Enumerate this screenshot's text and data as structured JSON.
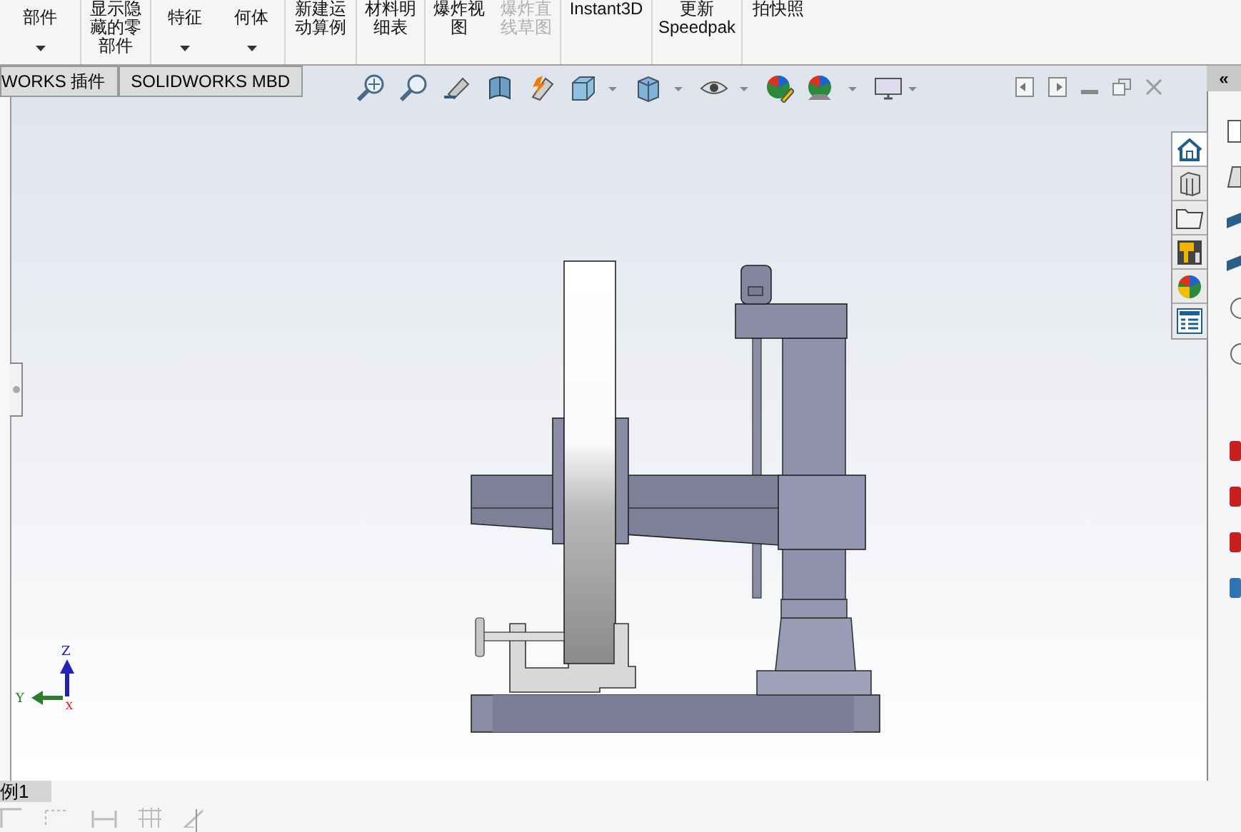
{
  "ribbon": {
    "groups": [
      {
        "lines": [
          "部件"
        ],
        "dropdown": true,
        "disabled": false
      },
      {
        "lines": [
          "显示隐",
          "藏的零",
          "部件"
        ],
        "dropdown": false,
        "disabled": false
      },
      {
        "lines": [
          "特征"
        ],
        "dropdown": true,
        "disabled": false
      },
      {
        "lines": [
          "何体"
        ],
        "dropdown": true,
        "disabled": false
      },
      {
        "lines": [
          "新建运",
          "动算例"
        ],
        "dropdown": false,
        "disabled": false
      },
      {
        "lines": [
          "材料明",
          "细表"
        ],
        "dropdown": false,
        "disabled": false
      },
      {
        "lines": [
          "爆炸视",
          "图"
        ],
        "dropdown": false,
        "disabled": false
      },
      {
        "lines": [
          "爆炸直",
          "线草图"
        ],
        "dropdown": false,
        "disabled": true
      },
      {
        "lines": [
          "Instant3D"
        ],
        "dropdown": false,
        "disabled": false
      },
      {
        "lines": [
          "更新",
          "Speedpak"
        ],
        "dropdown": false,
        "disabled": false
      },
      {
        "lines": [
          "拍快照"
        ],
        "dropdown": false,
        "disabled": false
      }
    ]
  },
  "tabs": [
    {
      "label": "WORKS 插件",
      "selected": false
    },
    {
      "label": "SOLIDWORKS MBD",
      "selected": false
    }
  ],
  "triad": {
    "z": "Z",
    "y": "Y",
    "x": "X"
  },
  "bottom_tabs": [
    {
      "label": "例1",
      "selected": true
    }
  ],
  "task_pane": {
    "collapse": "«"
  }
}
